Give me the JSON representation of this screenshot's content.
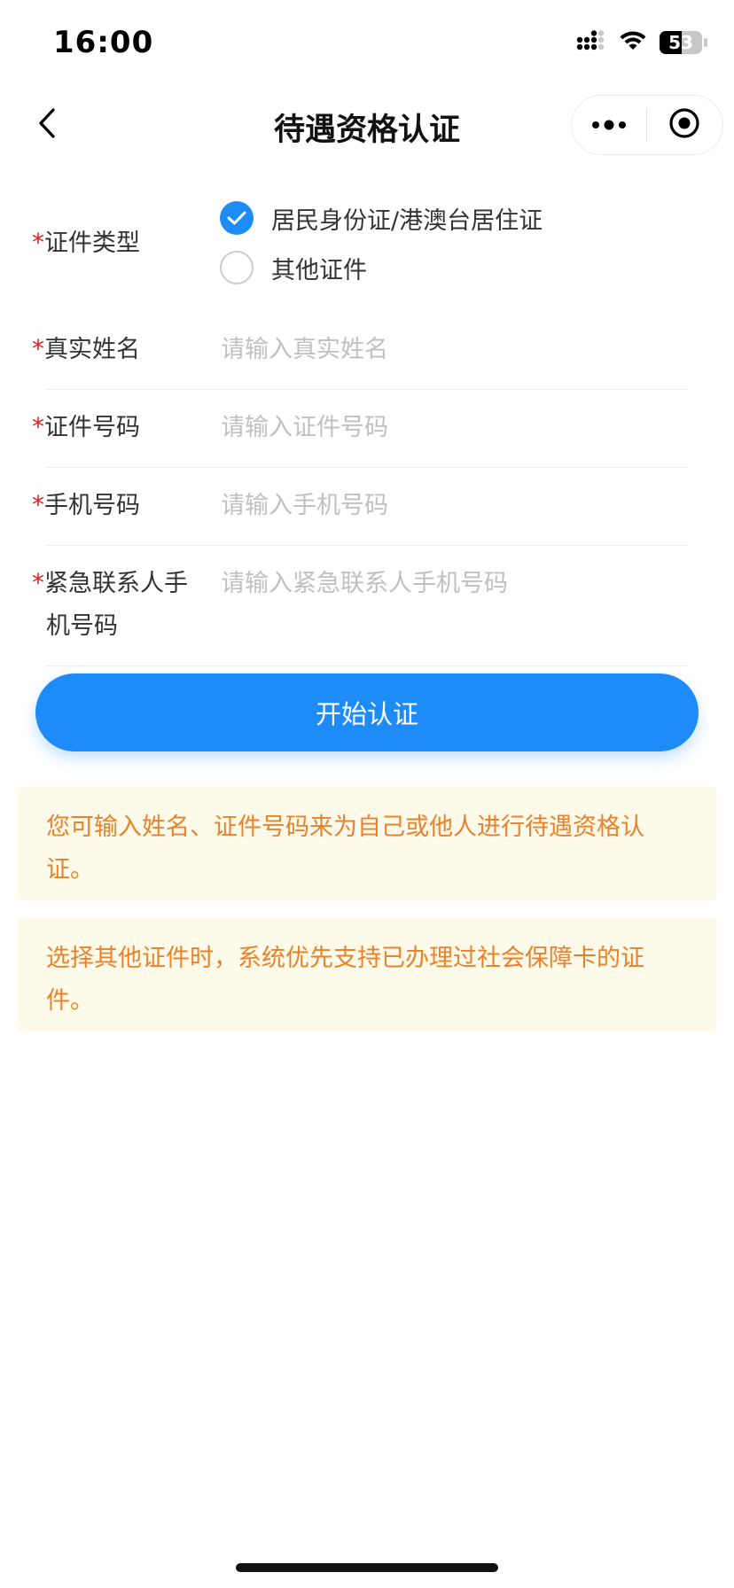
{
  "status_bar": {
    "time": "16:00",
    "battery": "53",
    "battery_level": 0.53
  },
  "nav": {
    "title": "待遇资格认证"
  },
  "form": {
    "cert_type": {
      "label": "证件类型",
      "options": [
        {
          "label": "居民身份证/港澳台居住证",
          "checked": true
        },
        {
          "label": "其他证件",
          "checked": false
        }
      ]
    },
    "name": {
      "label": "真实姓名",
      "placeholder": "请输入真实姓名"
    },
    "id_number": {
      "label": "证件号码",
      "placeholder": "请输入证件号码"
    },
    "phone": {
      "label": "手机号码",
      "placeholder": "请输入手机号码"
    },
    "emergency_phone": {
      "label_line1": "紧急联系人手",
      "label_line2": "机号码",
      "placeholder": "请输入紧急联系人手机号码"
    },
    "required_mark": "*"
  },
  "submit": {
    "label": "开始认证"
  },
  "notices": [
    {
      "line1": "您可输入姓名、证件号码来为自己或他人进行待遇资格认",
      "line2": "证。"
    },
    {
      "line1": "选择其他证件时，系统优先支持已办理过社会保障卡的证",
      "line2": "件。"
    }
  ],
  "colors": {
    "accent": "#1d8cf8",
    "required": "#e02020",
    "notice_text": "#e9822a",
    "notice_bg": "#fefae9"
  }
}
